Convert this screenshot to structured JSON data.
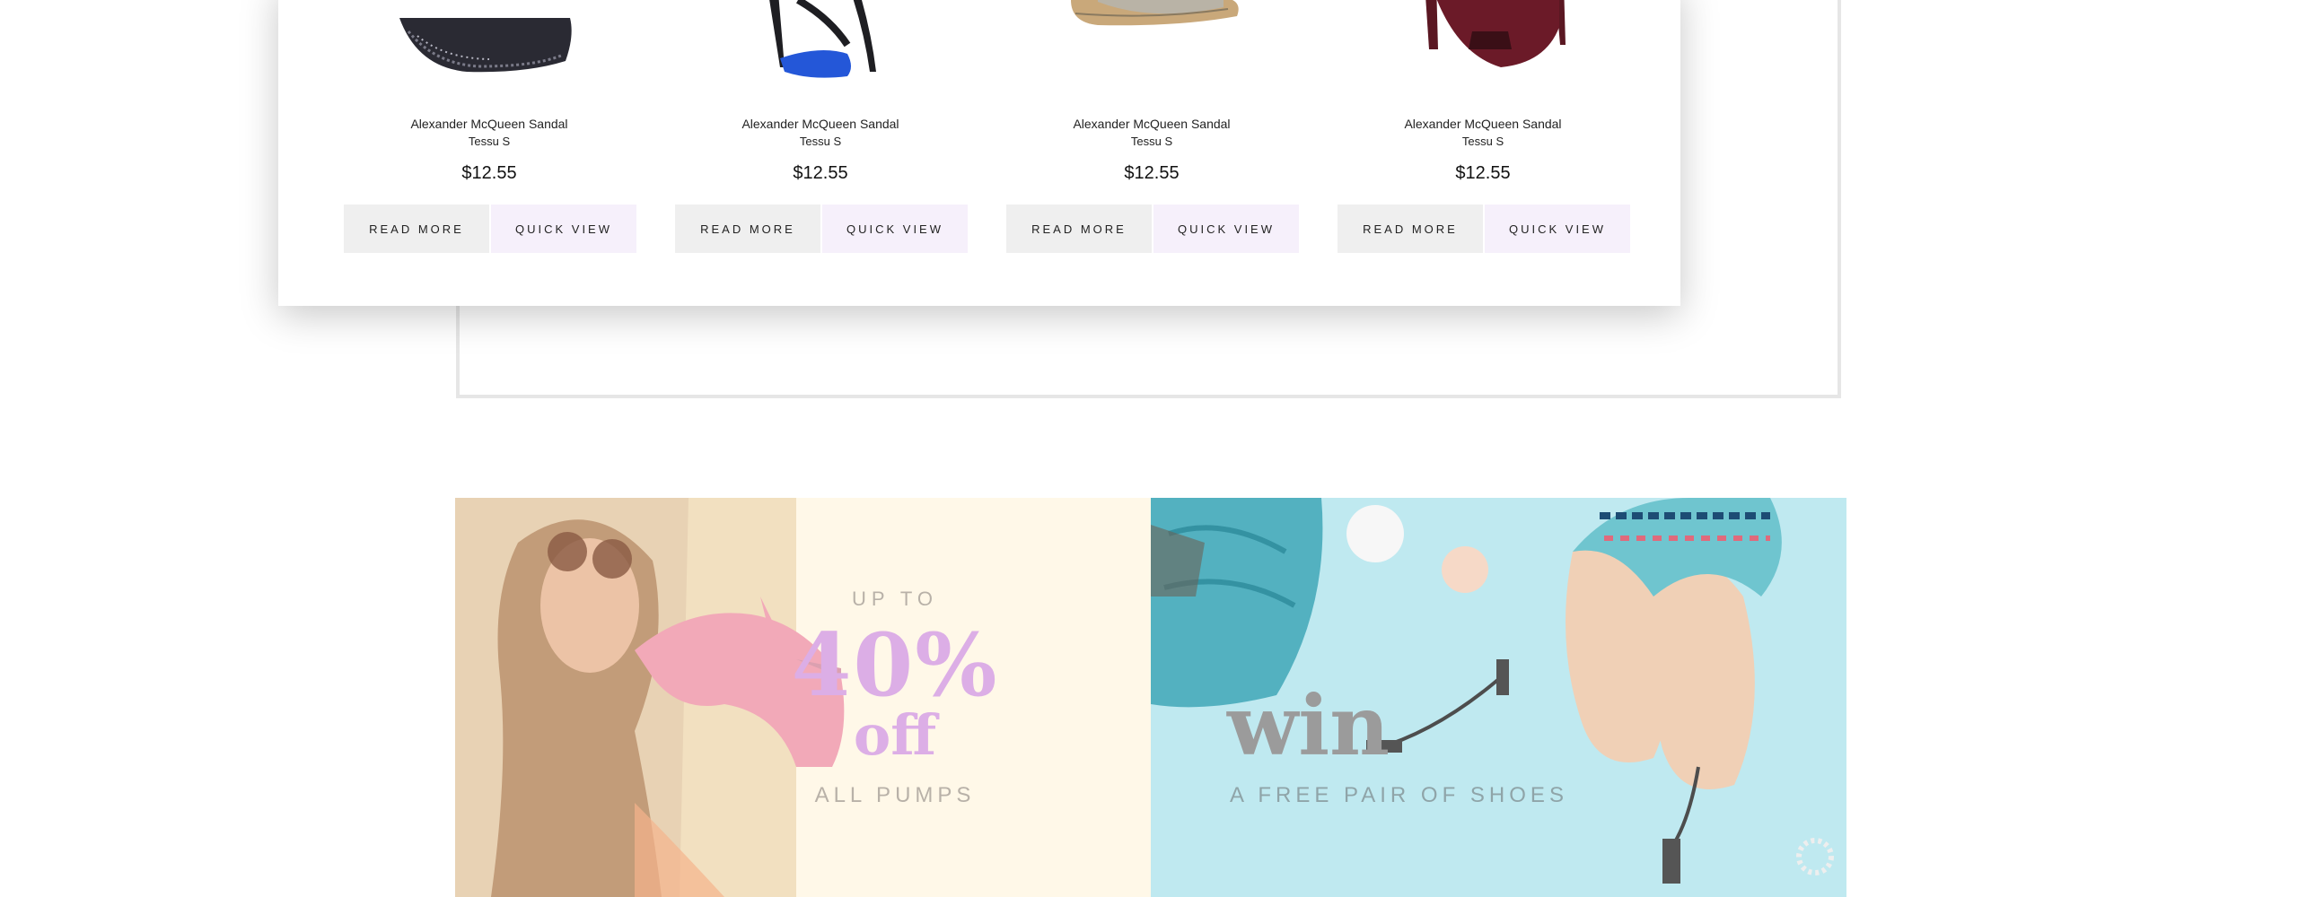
{
  "products": [
    {
      "name": "Alexander McQueen Sandal",
      "sub": "Tessu S",
      "price": "$12.55",
      "read_more": "READ MORE",
      "quick_view": "QUICK VIEW"
    },
    {
      "name": "Alexander McQueen Sandal",
      "sub": "Tessu S",
      "price": "$12.55",
      "read_more": "READ MORE",
      "quick_view": "QUICK VIEW"
    },
    {
      "name": "Alexander McQueen Sandal",
      "sub": "Tessu S",
      "price": "$12.55",
      "read_more": "READ MORE",
      "quick_view": "QUICK VIEW"
    },
    {
      "name": "Alexander McQueen Sandal",
      "sub": "Tessu S",
      "price": "$12.55",
      "read_more": "READ MORE",
      "quick_view": "QUICK VIEW"
    }
  ],
  "promo_left": {
    "up_to": "UP TO",
    "percent": "40%",
    "off": "off",
    "subtitle": "ALL PUMPS"
  },
  "promo_right": {
    "title": "win",
    "subtitle": "A FREE PAIR OF SHOES"
  },
  "colors": {
    "accent_pink": "#dcaee6",
    "read_more_bg": "#efefef",
    "quick_view_bg": "#f6f0fb",
    "banner_left_bg": "#fff8e8",
    "banner_right_bg": "#bfe9f0"
  }
}
